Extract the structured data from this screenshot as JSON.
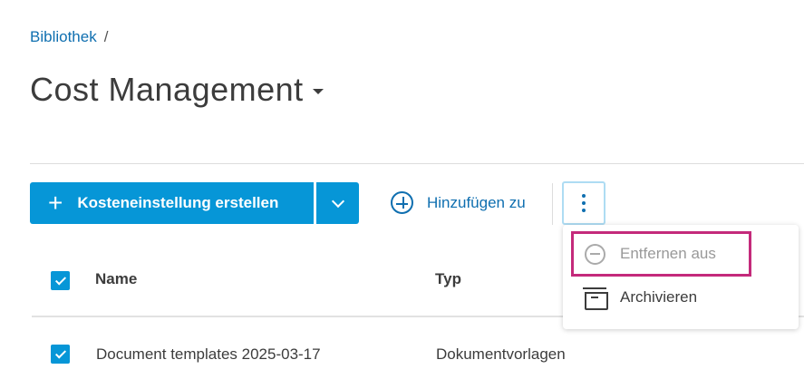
{
  "breadcrumb": {
    "items": [
      "Bibliothek"
    ],
    "separator": "/"
  },
  "title": "Cost Management",
  "toolbar": {
    "create_label": "Kosteneinstellung erstellen",
    "add_to_label": "Hinzufügen zu"
  },
  "menu": {
    "items": [
      {
        "label": "Entfernen aus",
        "icon": "remove-circle-icon",
        "disabled": true
      },
      {
        "label": "Archivieren",
        "icon": "archive-icon",
        "disabled": false
      }
    ]
  },
  "table": {
    "columns": [
      "Name",
      "Typ"
    ],
    "rows": [
      {
        "name": "Document templates 2025-03-17",
        "type": "Dokumentvorlagen",
        "checked": true
      }
    ],
    "all_checked": true
  },
  "colors": {
    "accent": "#0696d7",
    "link": "#0f6fb0",
    "highlight": "#c42a7b"
  }
}
